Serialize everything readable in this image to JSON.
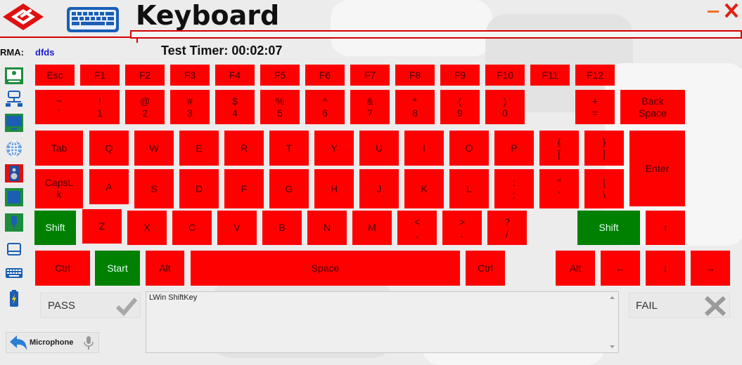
{
  "window": {
    "title": "Keyboard"
  },
  "rma": {
    "label": "RMA:",
    "value": "dfds"
  },
  "timer": {
    "label": "Test Timer: 00:02:07"
  },
  "sidebar": {
    "icons": [
      "system-info-icon",
      "network-icon",
      "display-icon",
      "globe-icon",
      "speaker-icon",
      "touchscreen-icon",
      "microphone-icon",
      "touchpad-icon",
      "keyboard-icon",
      "battery-icon"
    ]
  },
  "keyboard": {
    "colors": {
      "untested": "#ff0000",
      "passed": "#008000"
    },
    "rows": [
      [
        {
          "label": "Esc",
          "state": "untested"
        },
        {
          "label": "F1",
          "state": "untested"
        },
        {
          "label": "F2",
          "state": "untested"
        },
        {
          "label": "F3",
          "state": "untested"
        },
        {
          "label": "F4",
          "state": "untested"
        },
        {
          "label": "F5",
          "state": "untested"
        },
        {
          "label": "F6",
          "state": "untested"
        },
        {
          "label": "F7",
          "state": "untested"
        },
        {
          "label": "F8",
          "state": "untested"
        },
        {
          "label": "F9",
          "state": "untested"
        },
        {
          "label": "F10",
          "state": "untested"
        },
        {
          "label": "F11",
          "state": "untested"
        },
        {
          "label": "F12",
          "state": "untested"
        }
      ],
      [
        {
          "label": "~\n`",
          "state": "untested"
        },
        {
          "label": "!\n1",
          "state": "untested"
        },
        {
          "label": "@\n2",
          "state": "untested"
        },
        {
          "label": "#\n3",
          "state": "untested"
        },
        {
          "label": "$\n4",
          "state": "untested"
        },
        {
          "label": "%\n5",
          "state": "untested"
        },
        {
          "label": "^\n6",
          "state": "untested"
        },
        {
          "label": "&\n7",
          "state": "untested"
        },
        {
          "label": "*\n8",
          "state": "untested"
        },
        {
          "label": "(\n9",
          "state": "untested"
        },
        {
          "label": ")\n0",
          "state": "untested"
        },
        {
          "label": "+\n=",
          "state": "untested"
        },
        {
          "label": "Back\nSpace",
          "state": "untested"
        }
      ],
      [
        {
          "label": "Tab",
          "state": "untested"
        },
        {
          "label": "Q",
          "state": "untested"
        },
        {
          "label": "W",
          "state": "untested"
        },
        {
          "label": "E",
          "state": "untested"
        },
        {
          "label": "R",
          "state": "untested"
        },
        {
          "label": "T",
          "state": "untested"
        },
        {
          "label": "Y",
          "state": "untested"
        },
        {
          "label": "U",
          "state": "untested"
        },
        {
          "label": "I",
          "state": "untested"
        },
        {
          "label": "O",
          "state": "untested"
        },
        {
          "label": "P",
          "state": "untested"
        },
        {
          "label": "{\n[",
          "state": "untested"
        },
        {
          "label": "}\n]",
          "state": "untested"
        },
        {
          "label": "Enter",
          "state": "untested"
        }
      ],
      [
        {
          "label": "CapsL\nk",
          "state": "untested"
        },
        {
          "label": "A",
          "state": "untested"
        },
        {
          "label": "S",
          "state": "untested"
        },
        {
          "label": "D",
          "state": "untested"
        },
        {
          "label": "F",
          "state": "untested"
        },
        {
          "label": "G",
          "state": "untested"
        },
        {
          "label": "H",
          "state": "untested"
        },
        {
          "label": "J",
          "state": "untested"
        },
        {
          "label": "K",
          "state": "untested"
        },
        {
          "label": "L",
          "state": "untested"
        },
        {
          "label": ":\n;",
          "state": "untested"
        },
        {
          "label": "\"\n'",
          "state": "untested"
        },
        {
          "label": "|\n\\",
          "state": "untested"
        }
      ],
      [
        {
          "label": "Shift",
          "state": "passed"
        },
        {
          "label": "Z",
          "state": "untested"
        },
        {
          "label": "X",
          "state": "untested"
        },
        {
          "label": "C",
          "state": "untested"
        },
        {
          "label": "V",
          "state": "untested"
        },
        {
          "label": "B",
          "state": "untested"
        },
        {
          "label": "N",
          "state": "untested"
        },
        {
          "label": "M",
          "state": "untested"
        },
        {
          "label": "<\n,",
          "state": "untested"
        },
        {
          "label": ">\n.",
          "state": "untested"
        },
        {
          "label": "?\n/",
          "state": "untested"
        },
        {
          "label": "Shift",
          "state": "passed"
        },
        {
          "label": "↑",
          "state": "untested"
        }
      ],
      [
        {
          "label": "Ctrl",
          "state": "untested"
        },
        {
          "label": "Start",
          "state": "passed"
        },
        {
          "label": "Alt",
          "state": "untested"
        },
        {
          "label": "Space",
          "state": "untested"
        },
        {
          "label": "Ctrl",
          "state": "untested"
        },
        {
          "label": "Alt",
          "state": "untested"
        },
        {
          "label": "←",
          "state": "untested"
        },
        {
          "label": "↓",
          "state": "untested"
        },
        {
          "label": "→",
          "state": "untested"
        }
      ]
    ]
  },
  "pass": {
    "label": "PASS"
  },
  "fail": {
    "label": "FAIL"
  },
  "log": {
    "text": "LWin ShiftKey"
  },
  "microphone": {
    "label": "Microphone"
  }
}
